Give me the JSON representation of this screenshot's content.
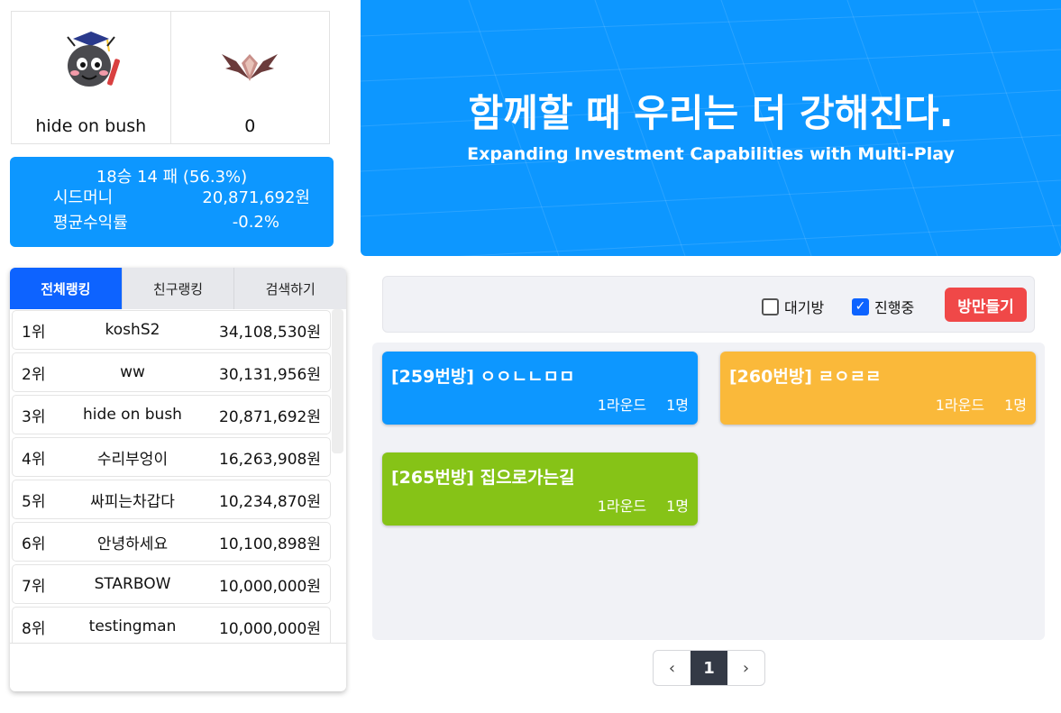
{
  "profile": {
    "username": "hide on bush",
    "tier_value": "0",
    "avatar_icon": "ant-graduate-icon",
    "tier_icon": "bat-wing-emblem-icon"
  },
  "stats": {
    "record": "18승 14 패 (56.3%)",
    "seed_label": "시드머니",
    "seed_value": "20,871,692원",
    "avg_label": "평균수익률",
    "avg_value": "-0.2%"
  },
  "ranking": {
    "tabs": [
      "전체랭킹",
      "친구랭킹",
      "검색하기"
    ],
    "items": [
      {
        "pos": "1위",
        "name": "koshS2",
        "amount": "34,108,530원"
      },
      {
        "pos": "2위",
        "name": "ww",
        "amount": "30,131,956원"
      },
      {
        "pos": "3위",
        "name": "hide on bush",
        "amount": "20,871,692원"
      },
      {
        "pos": "4위",
        "name": "수리부엉이",
        "amount": "16,263,908원"
      },
      {
        "pos": "5위",
        "name": "싸피는차갑다",
        "amount": "10,234,870원"
      },
      {
        "pos": "6위",
        "name": "안녕하세요",
        "amount": "10,100,898원"
      },
      {
        "pos": "7위",
        "name": "STARBOW",
        "amount": "10,000,000원"
      },
      {
        "pos": "8위",
        "name": "testingman",
        "amount": "10,000,000원"
      }
    ]
  },
  "banner": {
    "title": "함께할 때 우리는 더 강해진다.",
    "subtitle": "Expanding Investment Capabilities with Multi-Play"
  },
  "filters": {
    "waiting_label": "대기방",
    "waiting_checked": false,
    "playing_label": "진행중",
    "playing_checked": true,
    "create_label": "방만들기"
  },
  "rooms": [
    {
      "title": "[259번방] ㅇㅇㄴㄴㅁㅁ",
      "round": "1라운드",
      "people": "1명",
      "color": "#0d97ff"
    },
    {
      "title": "[260번방] ㄹㅇㄹㄹ",
      "round": "1라운드",
      "people": "1명",
      "color": "#fab93a"
    },
    {
      "title": "[265번방] 집으로가는길",
      "round": "1라운드",
      "people": "1명",
      "color": "#86c317"
    }
  ],
  "pager": {
    "prev": "‹",
    "current": "1",
    "next": "›"
  }
}
